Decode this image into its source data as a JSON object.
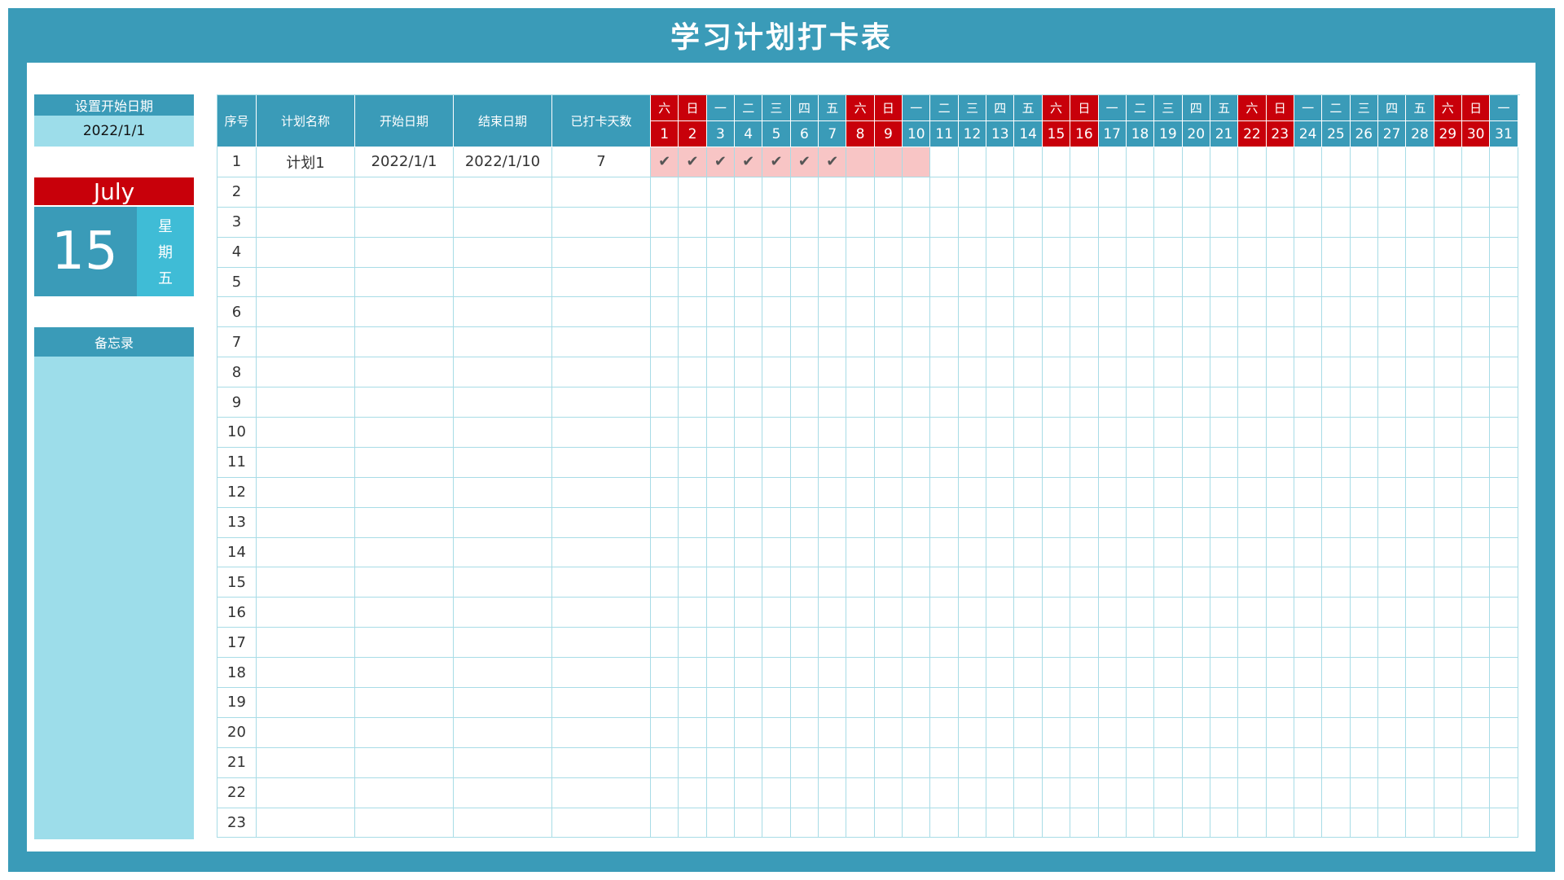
{
  "title": "学习计划打卡表",
  "start_date": {
    "label": "设置开始日期",
    "value": "2022/1/1"
  },
  "calendar": {
    "month": "July",
    "day": "15",
    "weekday_chars": [
      "星",
      "期",
      "五"
    ]
  },
  "memo": {
    "label": "备忘录"
  },
  "table": {
    "headers": {
      "index": "序号",
      "plan_name": "计划名称",
      "start_date": "开始日期",
      "end_date": "结束日期",
      "checked_days": "已打卡天数"
    },
    "days": [
      {
        "w": "六",
        "d": "1",
        "weekend": true
      },
      {
        "w": "日",
        "d": "2",
        "weekend": true
      },
      {
        "w": "一",
        "d": "3",
        "weekend": false
      },
      {
        "w": "二",
        "d": "4",
        "weekend": false
      },
      {
        "w": "三",
        "d": "5",
        "weekend": false
      },
      {
        "w": "四",
        "d": "6",
        "weekend": false
      },
      {
        "w": "五",
        "d": "7",
        "weekend": false
      },
      {
        "w": "六",
        "d": "8",
        "weekend": true
      },
      {
        "w": "日",
        "d": "9",
        "weekend": true
      },
      {
        "w": "一",
        "d": "10",
        "weekend": false
      },
      {
        "w": "二",
        "d": "11",
        "weekend": false
      },
      {
        "w": "三",
        "d": "12",
        "weekend": false
      },
      {
        "w": "四",
        "d": "13",
        "weekend": false
      },
      {
        "w": "五",
        "d": "14",
        "weekend": false
      },
      {
        "w": "六",
        "d": "15",
        "weekend": true
      },
      {
        "w": "日",
        "d": "16",
        "weekend": true
      },
      {
        "w": "一",
        "d": "17",
        "weekend": false
      },
      {
        "w": "二",
        "d": "18",
        "weekend": false
      },
      {
        "w": "三",
        "d": "19",
        "weekend": false
      },
      {
        "w": "四",
        "d": "20",
        "weekend": false
      },
      {
        "w": "五",
        "d": "21",
        "weekend": false
      },
      {
        "w": "六",
        "d": "22",
        "weekend": true
      },
      {
        "w": "日",
        "d": "23",
        "weekend": true
      },
      {
        "w": "一",
        "d": "24",
        "weekend": false
      },
      {
        "w": "二",
        "d": "25",
        "weekend": false
      },
      {
        "w": "三",
        "d": "26",
        "weekend": false
      },
      {
        "w": "四",
        "d": "27",
        "weekend": false
      },
      {
        "w": "五",
        "d": "28",
        "weekend": false
      },
      {
        "w": "六",
        "d": "29",
        "weekend": true
      },
      {
        "w": "日",
        "d": "30",
        "weekend": true
      },
      {
        "w": "一",
        "d": "31",
        "weekend": false
      }
    ],
    "rows": [
      {
        "index": "1",
        "name": "计划1",
        "start": "2022/1/1",
        "end": "2022/1/10",
        "checked": "7",
        "marks": [
          "✔",
          "✔",
          "✔",
          "✔",
          "✔",
          "✔",
          "✔",
          "",
          "",
          ""
        ]
      },
      {
        "index": "2"
      },
      {
        "index": "3"
      },
      {
        "index": "4"
      },
      {
        "index": "5"
      },
      {
        "index": "6"
      },
      {
        "index": "7"
      },
      {
        "index": "8"
      },
      {
        "index": "9"
      },
      {
        "index": "10"
      },
      {
        "index": "11"
      },
      {
        "index": "12"
      },
      {
        "index": "13"
      },
      {
        "index": "14"
      },
      {
        "index": "15"
      },
      {
        "index": "16"
      },
      {
        "index": "17"
      },
      {
        "index": "18"
      },
      {
        "index": "19"
      },
      {
        "index": "20"
      },
      {
        "index": "21"
      },
      {
        "index": "22"
      },
      {
        "index": "23"
      }
    ]
  },
  "colors": {
    "primary": "#3a9bb8",
    "light": "#9dddea",
    "accent": "#3fbcd6",
    "weekend": "#c8000a",
    "checked": "#f8c5c5",
    "grid": "#a8dce6"
  }
}
